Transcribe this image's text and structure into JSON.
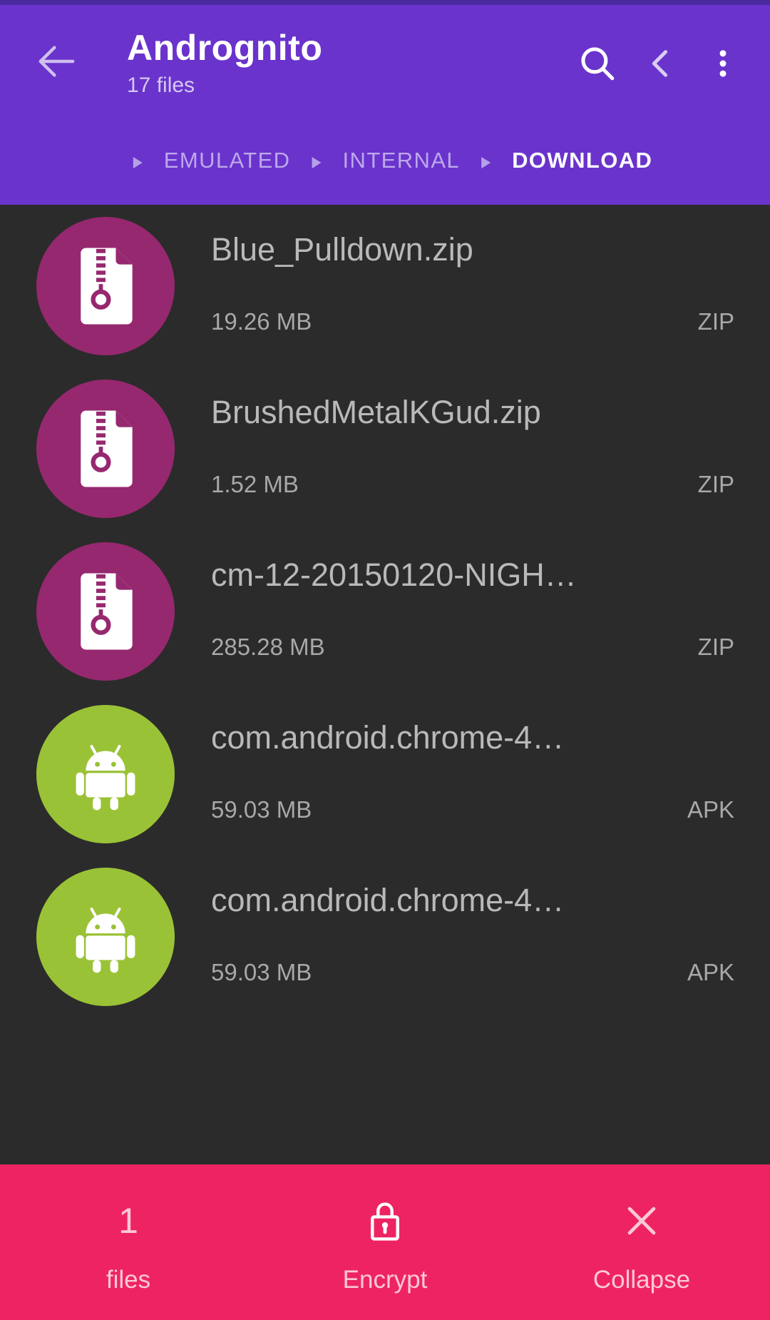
{
  "app": {
    "title": "Andrognito",
    "subtitle": "17 files",
    "accent_purple": "#6a33cc",
    "accent_pink": "#ee2462",
    "list_background": "#2b2b2b",
    "zip_circle_color": "#96286f",
    "apk_circle_color": "#9ac236"
  },
  "appbar": {
    "back_icon": "back-arrow-icon",
    "actions": [
      {
        "icon": "search-icon",
        "name": "search"
      },
      {
        "icon": "chevron-left-icon",
        "name": "previous"
      },
      {
        "icon": "overflow-menu-icon",
        "name": "more-options"
      }
    ]
  },
  "breadcrumb": {
    "separator": "▸",
    "items": [
      {
        "label": "EMULATED",
        "current": false
      },
      {
        "label": "INTERNAL",
        "current": false
      },
      {
        "label": "DOWNLOAD",
        "current": true
      }
    ]
  },
  "files": [
    {
      "name": "Blue_Pulldown.zip",
      "size": "19.26 MB",
      "type": "ZIP",
      "icon": "zip-file-icon"
    },
    {
      "name": "BrushedMetalKGud.zip",
      "size": "1.52 MB",
      "type": "ZIP",
      "icon": "zip-file-icon"
    },
    {
      "name": "cm-12-20150120-NIGH…",
      "size": "285.28 MB",
      "type": "ZIP",
      "icon": "zip-file-icon"
    },
    {
      "name": "com.android.chrome-4…",
      "size": "59.03 MB",
      "type": "APK",
      "icon": "android-robot-icon"
    },
    {
      "name": "com.android.chrome-4…",
      "size": "59.03 MB",
      "type": "APK",
      "icon": "android-robot-icon"
    }
  ],
  "bottombar": {
    "count": "1",
    "count_label": "files",
    "encrypt_label": "Encrypt",
    "encrypt_icon": "lock-icon",
    "collapse_label": "Collapse",
    "collapse_icon": "close-x-icon"
  }
}
